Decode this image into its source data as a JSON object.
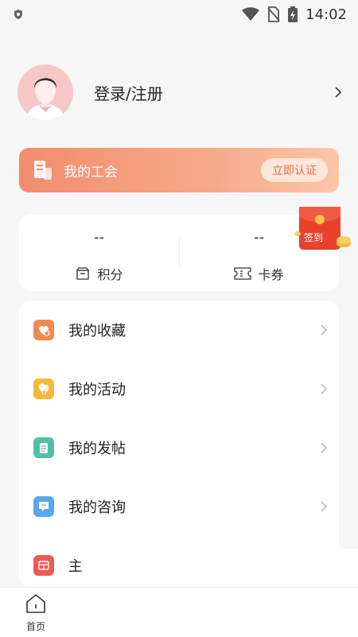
{
  "status_bar": {
    "time": "14:02"
  },
  "profile": {
    "login_label": "登录/注册"
  },
  "union": {
    "title": "我的工会",
    "verify_label": "立即认证"
  },
  "stats": {
    "points": {
      "value": "--",
      "label": "积分"
    },
    "coupons": {
      "value": "--",
      "label": "卡券"
    }
  },
  "signin": {
    "label": "签到"
  },
  "menu": {
    "items": [
      {
        "label": "我的收藏",
        "icon": "favorite-heart-icon",
        "color": "#f08a4f"
      },
      {
        "label": "我的活动",
        "icon": "balloon-icon",
        "color": "#f3b93c"
      },
      {
        "label": "我的发帖",
        "icon": "clipboard-icon",
        "color": "#4fc0a6"
      },
      {
        "label": "我的咨询",
        "icon": "chat-icon",
        "color": "#5aa6ea"
      },
      {
        "label": "主",
        "icon": "homepage-icon",
        "color": "#ef5a55"
      }
    ]
  },
  "tabbar": {
    "home_label": "首页"
  },
  "colors": {
    "accent": "#f28c6d",
    "verify_text": "#e46f4c"
  }
}
